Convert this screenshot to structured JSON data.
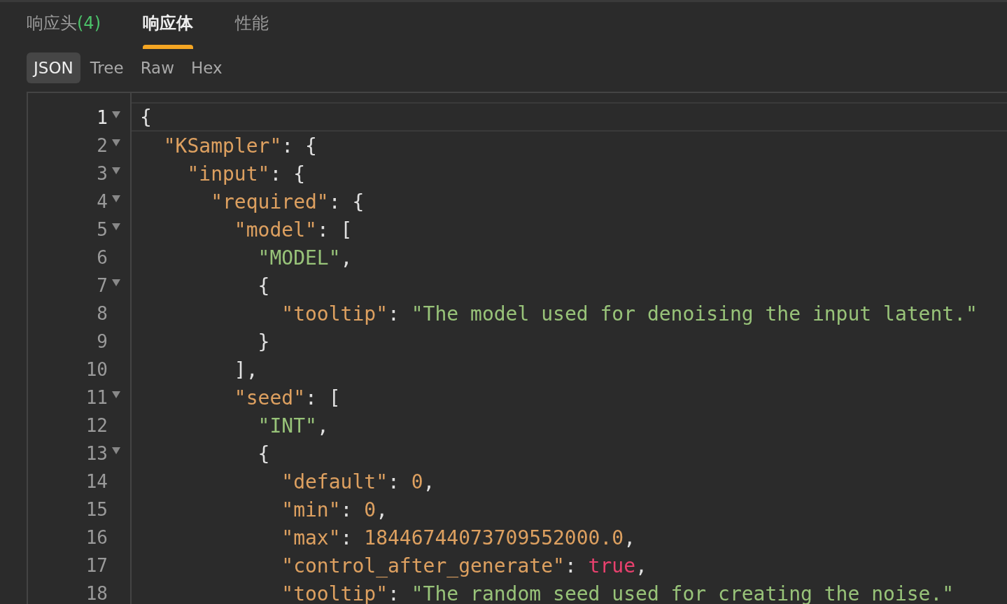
{
  "response_tabs": [
    {
      "label": "响应头",
      "count": "(4)",
      "selected": false
    },
    {
      "label": "响应体",
      "selected": true
    },
    {
      "label": "性能",
      "selected": false
    }
  ],
  "view_tabs": [
    {
      "label": "JSON",
      "selected": true
    },
    {
      "label": "Tree",
      "selected": false
    },
    {
      "label": "Raw",
      "selected": false
    },
    {
      "label": "Hex",
      "selected": false
    }
  ],
  "editor": {
    "lines": [
      {
        "number": "1",
        "foldable": true,
        "active": true,
        "tokens": [
          {
            "kind": "punct",
            "text": "{"
          }
        ]
      },
      {
        "number": "2",
        "foldable": true,
        "active": false,
        "tokens": [
          {
            "kind": "key",
            "text": "  \"KSampler\""
          },
          {
            "kind": "punct",
            "text": ": {"
          }
        ]
      },
      {
        "number": "3",
        "foldable": true,
        "active": false,
        "tokens": [
          {
            "kind": "key",
            "text": "    \"input\""
          },
          {
            "kind": "punct",
            "text": ": {"
          }
        ]
      },
      {
        "number": "4",
        "foldable": true,
        "active": false,
        "tokens": [
          {
            "kind": "key",
            "text": "      \"required\""
          },
          {
            "kind": "punct",
            "text": ": {"
          }
        ]
      },
      {
        "number": "5",
        "foldable": true,
        "active": false,
        "tokens": [
          {
            "kind": "key",
            "text": "        \"model\""
          },
          {
            "kind": "punct",
            "text": ": ["
          }
        ]
      },
      {
        "number": "6",
        "foldable": false,
        "active": false,
        "tokens": [
          {
            "kind": "string",
            "text": "          \"MODEL\""
          },
          {
            "kind": "punct",
            "text": ","
          }
        ]
      },
      {
        "number": "7",
        "foldable": true,
        "active": false,
        "tokens": [
          {
            "kind": "punct",
            "text": "          {"
          }
        ]
      },
      {
        "number": "8",
        "foldable": false,
        "active": false,
        "tokens": [
          {
            "kind": "key",
            "text": "            \"tooltip\""
          },
          {
            "kind": "punct",
            "text": ": "
          },
          {
            "kind": "string",
            "text": "\"The model used for denoising the input latent.\""
          }
        ]
      },
      {
        "number": "9",
        "foldable": false,
        "active": false,
        "tokens": [
          {
            "kind": "punct",
            "text": "          }"
          }
        ]
      },
      {
        "number": "10",
        "foldable": false,
        "active": false,
        "tokens": [
          {
            "kind": "punct",
            "text": "        ],"
          }
        ]
      },
      {
        "number": "11",
        "foldable": true,
        "active": false,
        "tokens": [
          {
            "kind": "key",
            "text": "        \"seed\""
          },
          {
            "kind": "punct",
            "text": ": ["
          }
        ]
      },
      {
        "number": "12",
        "foldable": false,
        "active": false,
        "tokens": [
          {
            "kind": "string",
            "text": "          \"INT\""
          },
          {
            "kind": "punct",
            "text": ","
          }
        ]
      },
      {
        "number": "13",
        "foldable": true,
        "active": false,
        "tokens": [
          {
            "kind": "punct",
            "text": "          {"
          }
        ]
      },
      {
        "number": "14",
        "foldable": false,
        "active": false,
        "tokens": [
          {
            "kind": "key",
            "text": "            \"default\""
          },
          {
            "kind": "punct",
            "text": ": "
          },
          {
            "kind": "number",
            "text": "0"
          },
          {
            "kind": "punct",
            "text": ","
          }
        ]
      },
      {
        "number": "15",
        "foldable": false,
        "active": false,
        "tokens": [
          {
            "kind": "key",
            "text": "            \"min\""
          },
          {
            "kind": "punct",
            "text": ": "
          },
          {
            "kind": "number",
            "text": "0"
          },
          {
            "kind": "punct",
            "text": ","
          }
        ]
      },
      {
        "number": "16",
        "foldable": false,
        "active": false,
        "tokens": [
          {
            "kind": "key",
            "text": "            \"max\""
          },
          {
            "kind": "punct",
            "text": ": "
          },
          {
            "kind": "number",
            "text": "18446744073709552000.0"
          },
          {
            "kind": "punct",
            "text": ","
          }
        ]
      },
      {
        "number": "17",
        "foldable": false,
        "active": false,
        "tokens": [
          {
            "kind": "key",
            "text": "            \"control_after_generate\""
          },
          {
            "kind": "punct",
            "text": ": "
          },
          {
            "kind": "boolean",
            "text": "true"
          },
          {
            "kind": "punct",
            "text": ","
          }
        ]
      },
      {
        "number": "18",
        "foldable": false,
        "active": false,
        "tokens": [
          {
            "kind": "key",
            "text": "            \"tooltip\""
          },
          {
            "kind": "punct",
            "text": ": "
          },
          {
            "kind": "string",
            "text": "\"The random seed used for creating the noise.\""
          }
        ]
      }
    ]
  }
}
